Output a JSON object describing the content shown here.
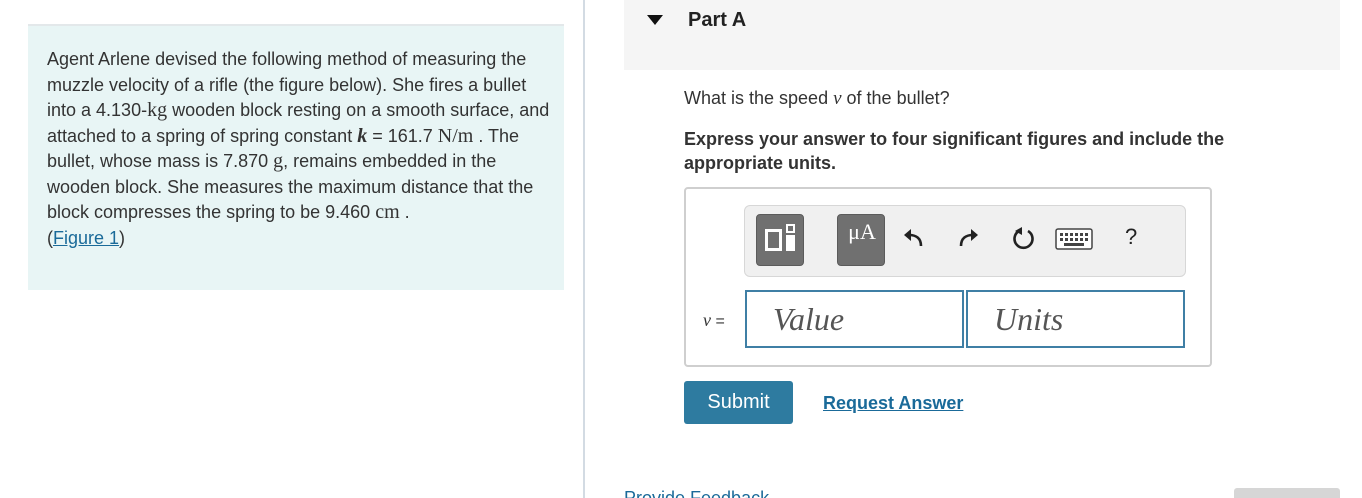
{
  "problem": {
    "text_1": "Agent Arlene devised the following method of measuring the muzzle velocity of a rifle (the figure below). She fires a bullet into a 4.130-",
    "unit_kg": "kg",
    "text_2": " wooden block resting on a smooth surface, and attached to a spring of spring constant ",
    "var_k": "k",
    "text_3": " = 161.7 ",
    "unit_nm": "N/m",
    "text_4": " . The bullet, whose mass is 7.870 ",
    "unit_g": "g",
    "text_5": ", remains embedded in the wooden block. She measures the maximum distance that the block compresses the spring to be 9.460 ",
    "unit_cm": "cm",
    "text_6": " .",
    "figure_open": "(",
    "figure_link": "Figure 1",
    "figure_close": ")"
  },
  "part": {
    "title": "Part A",
    "question_prefix": "What is the speed ",
    "question_var": "v",
    "question_suffix": " of the bullet?",
    "instruction": "Express your answer to four significant figures and include the appropriate units."
  },
  "toolbar": {
    "units_symbol": "μA",
    "help": "?"
  },
  "answer": {
    "var": "v",
    "equals": " =",
    "value_placeholder": "Value",
    "units_placeholder": "Units"
  },
  "actions": {
    "submit": "Submit",
    "request_answer": "Request Answer",
    "provide_feedback": "Provide Feedback"
  },
  "colors": {
    "problem_bg": "#e8f5f5",
    "accent": "#2e7ba0",
    "link": "#1a6a99",
    "field_border": "#3f7fa5"
  }
}
